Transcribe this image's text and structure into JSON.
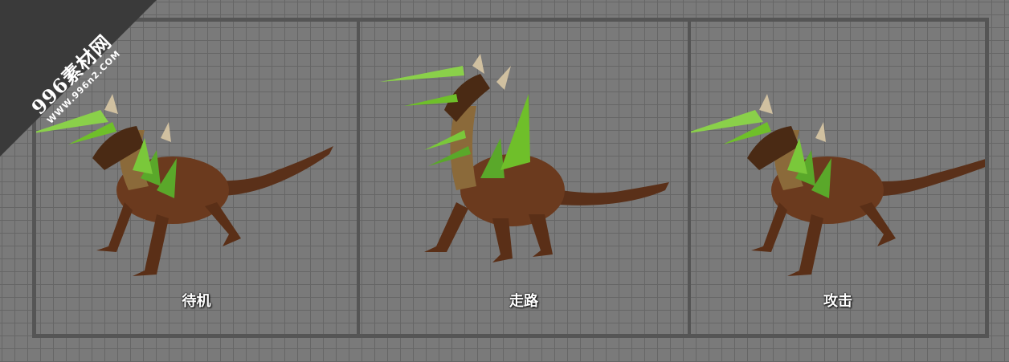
{
  "watermark": {
    "main": "996素材网",
    "sub": "WWW.996n2.COM"
  },
  "panels": [
    {
      "label": "待机"
    },
    {
      "label": "走路"
    },
    {
      "label": "攻击"
    }
  ],
  "colors": {
    "background": "#7a7a7a",
    "grid": "#666666",
    "frame": "#555555",
    "dragon_body": "#6b3a1e",
    "dragon_spikes": "#6fbf2a",
    "caption": "#ffffff"
  }
}
